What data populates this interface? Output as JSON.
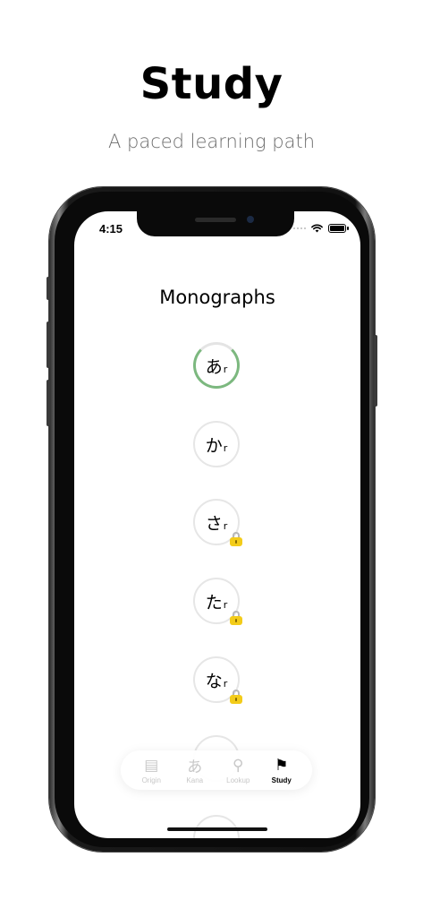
{
  "headline": "Study",
  "subheadline": "A paced learning path",
  "status_bar": {
    "time": "4:15"
  },
  "screen": {
    "section_title": "Monographs",
    "lessons": [
      {
        "kana": "あ",
        "sub": "r",
        "state": "in-progress",
        "progress": 0.7,
        "locked": false
      },
      {
        "kana": "か",
        "sub": "r",
        "state": "available",
        "locked": false
      },
      {
        "kana": "さ",
        "sub": "r",
        "state": "locked",
        "locked": true
      },
      {
        "kana": "た",
        "sub": "r",
        "state": "locked",
        "locked": true
      },
      {
        "kana": "な",
        "sub": "r",
        "state": "locked",
        "locked": true
      }
    ]
  },
  "tab_bar": {
    "tabs": [
      {
        "label": "Origin",
        "icon": "list-icon",
        "glyph": "▤",
        "selected": false
      },
      {
        "label": "Kana",
        "icon": "kana-icon",
        "glyph": "あ",
        "selected": false
      },
      {
        "label": "Lookup",
        "icon": "search-icon",
        "glyph": "⚲",
        "selected": false
      },
      {
        "label": "Study",
        "icon": "flag-icon",
        "glyph": "⚑",
        "selected": true
      }
    ]
  },
  "colors": {
    "progress": "#7cb87f",
    "lock": "#f3cc1a",
    "tab_inactive": "#c8c8c8"
  }
}
